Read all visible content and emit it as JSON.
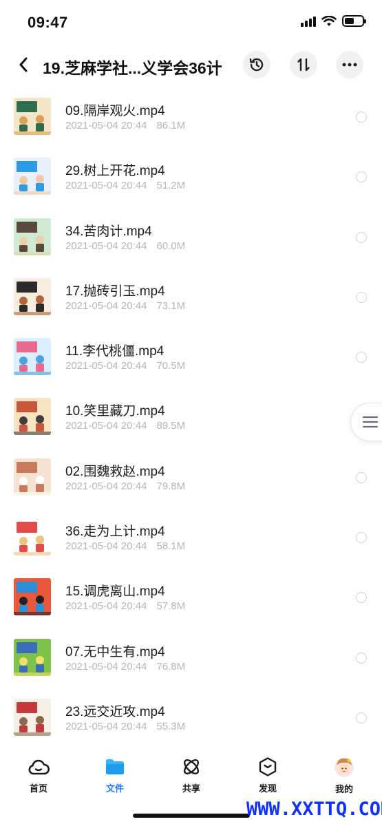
{
  "status_bar": {
    "time": "09:47",
    "battery_level": 0.55
  },
  "header": {
    "title": "19.芝麻学社...义学会36计",
    "back_icon": "chevron-left-icon",
    "history_icon": "history-icon",
    "sort_icon": "sort-icon",
    "more_icon": "more-horizontal-icon"
  },
  "files": [
    {
      "name": "09.隔岸观火.mp4",
      "date": "2021-05-04 20:44",
      "size": "86.1M",
      "thumb_colors": [
        "#f4e7c8",
        "#2f6d4f",
        "#d9a25a"
      ]
    },
    {
      "name": "29.树上开花.mp4",
      "date": "2021-05-04 20:44",
      "size": "51.2M",
      "thumb_colors": [
        "#e8f0fb",
        "#2d9be6",
        "#f3c9a5"
      ]
    },
    {
      "name": "34.苦肉计.mp4",
      "date": "2021-05-04 20:44",
      "size": "60.0M",
      "thumb_colors": [
        "#cfe9d2",
        "#5b4a3b",
        "#e7d3a8"
      ]
    },
    {
      "name": "17.抛砖引玉.mp4",
      "date": "2021-05-04 20:44",
      "size": "73.1M",
      "thumb_colors": [
        "#f6ede0",
        "#2b2b2b",
        "#b5643a"
      ]
    },
    {
      "name": "11.李代桃僵.mp4",
      "date": "2021-05-04 20:44",
      "size": "70.5M",
      "thumb_colors": [
        "#dcefff",
        "#e96a8c",
        "#4aa3df"
      ]
    },
    {
      "name": "10.笑里藏刀.mp4",
      "date": "2021-05-04 20:44",
      "size": "89.5M",
      "thumb_colors": [
        "#f7e2c2",
        "#c8573b",
        "#3f3f3f"
      ]
    },
    {
      "name": "02.围魏救赵.mp4",
      "date": "2021-05-04 20:44",
      "size": "79.8M",
      "thumb_colors": [
        "#f3e3d0",
        "#c97a5a",
        "#ffffff"
      ]
    },
    {
      "name": "36.走为上计.mp4",
      "date": "2021-05-04 20:44",
      "size": "58.1M",
      "thumb_colors": [
        "#ffffff",
        "#e34a4a",
        "#f1c27d"
      ]
    },
    {
      "name": "15.调虎离山.mp4",
      "date": "2021-05-04 20:44",
      "size": "57.8M",
      "thumb_colors": [
        "#e9573d",
        "#2a8fd6",
        "#222222"
      ]
    },
    {
      "name": "07.无中生有.mp4",
      "date": "2021-05-04 20:44",
      "size": "76.8M",
      "thumb_colors": [
        "#7fc24a",
        "#3a6fb8",
        "#f2e06a"
      ]
    },
    {
      "name": "23.远交近攻.mp4",
      "date": "2021-05-04 20:44",
      "size": "55.3M",
      "thumb_colors": [
        "#f5efe6",
        "#c23b3b",
        "#8a6a4a"
      ]
    }
  ],
  "side_handle_icon": "menu-lines-icon",
  "tabbar": {
    "tabs": [
      {
        "label": "首页",
        "icon": "cloud-icon",
        "active": false
      },
      {
        "label": "文件",
        "icon": "folder-icon",
        "active": true
      },
      {
        "label": "共享",
        "icon": "atom-icon",
        "active": false
      },
      {
        "label": "发现",
        "icon": "cube-icon",
        "active": false
      },
      {
        "label": "我的",
        "icon": "avatar-icon",
        "active": false
      }
    ]
  },
  "watermark": "WWW.XXTTQ.COM",
  "colors": {
    "accent": "#1e7bff",
    "text": "#1b1b1f",
    "meta": "#b4b6bd",
    "watermark": "#1030ff"
  }
}
